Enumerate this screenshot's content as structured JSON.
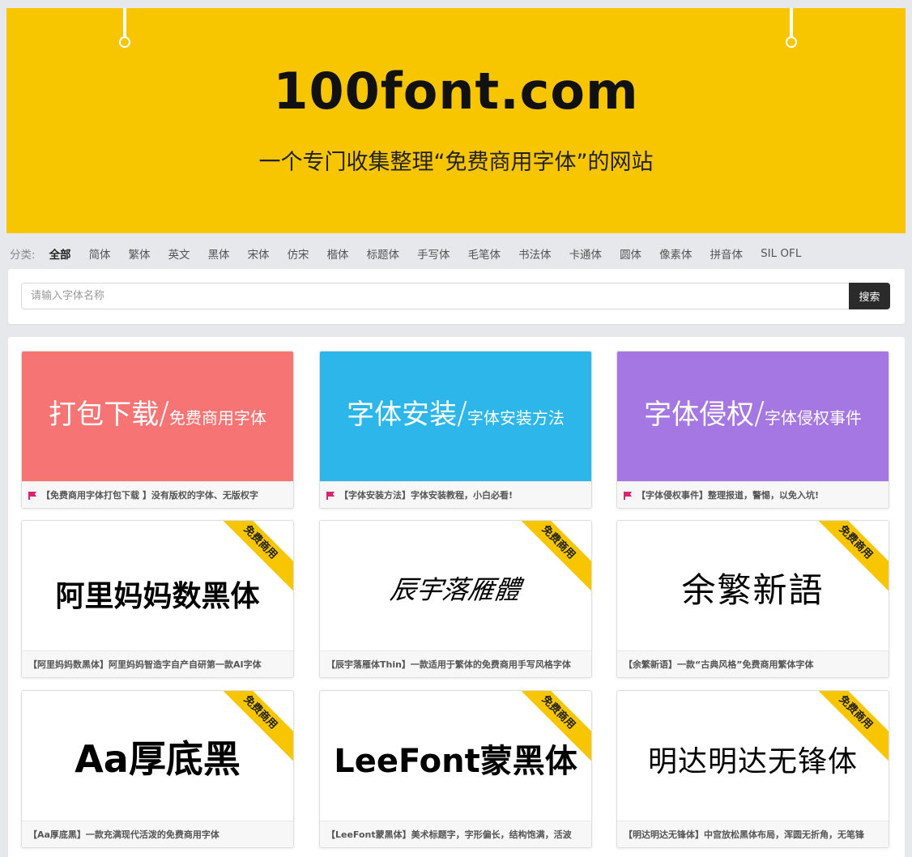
{
  "banner": {
    "title": "100font.com",
    "subtitle": "一个专门收集整理“免费商用字体”的网站",
    "background": "#f7c600"
  },
  "categories": {
    "label": "分类:",
    "items": [
      "全部",
      "简体",
      "繁体",
      "英文",
      "黑体",
      "宋体",
      "仿宋",
      "楷体",
      "标题体",
      "手写体",
      "毛笔体",
      "书法体",
      "卡通体",
      "圆体",
      "像素体",
      "拼音体",
      "SIL OFL"
    ],
    "active": "全部"
  },
  "search": {
    "placeholder": "请输入字体名称",
    "value": "",
    "button_label": "搜索"
  },
  "promos": [
    {
      "big": "打包下载",
      "small": "免费商用字体",
      "color": "#f77474",
      "caption": "【免费商用字体打包下载 】没有版权的字体、无版权字",
      "icon": "flag-icon"
    },
    {
      "big": "字体安装",
      "small": "字体安装方法",
      "color": "#2db6ea",
      "caption": "【字体安装方法】字体安装教程，小白必看!",
      "icon": "flag-icon"
    },
    {
      "big": "字体侵权",
      "small": "字体侵权事件",
      "color": "#a477e3",
      "caption": "【字体侵权事件】整理报道，警惕，以免入坑!",
      "icon": "flag-icon"
    }
  ],
  "ribbon_label": "免费商用",
  "fonts": [
    {
      "preview": "阿里妈妈数黑体",
      "caption": "【阿里妈妈数黑体】阿里妈妈智造字自产自研第一款AI字体"
    },
    {
      "preview": "辰宇落雁體",
      "caption": "【辰宇落雁体Thin】一款适用于繁体的免费商用手写风格字体"
    },
    {
      "preview": "余繁新語",
      "caption": "【余繁新语】一款“古典风格”免费商用繁体字体"
    },
    {
      "preview": "Aa厚底黑",
      "caption": "【Aa厚底黑】一款充满现代活泼的免费商用字体"
    },
    {
      "preview": "LeeFont蒙黑体",
      "caption": "【LeeFont蒙黑体】美术标题字，字形偏长，结构饱满，活波"
    },
    {
      "preview": "明达明达无锋体",
      "caption": "【明达明达无锋体】中宫放松黑体布局，浑圆无折角，无笔锋"
    }
  ]
}
